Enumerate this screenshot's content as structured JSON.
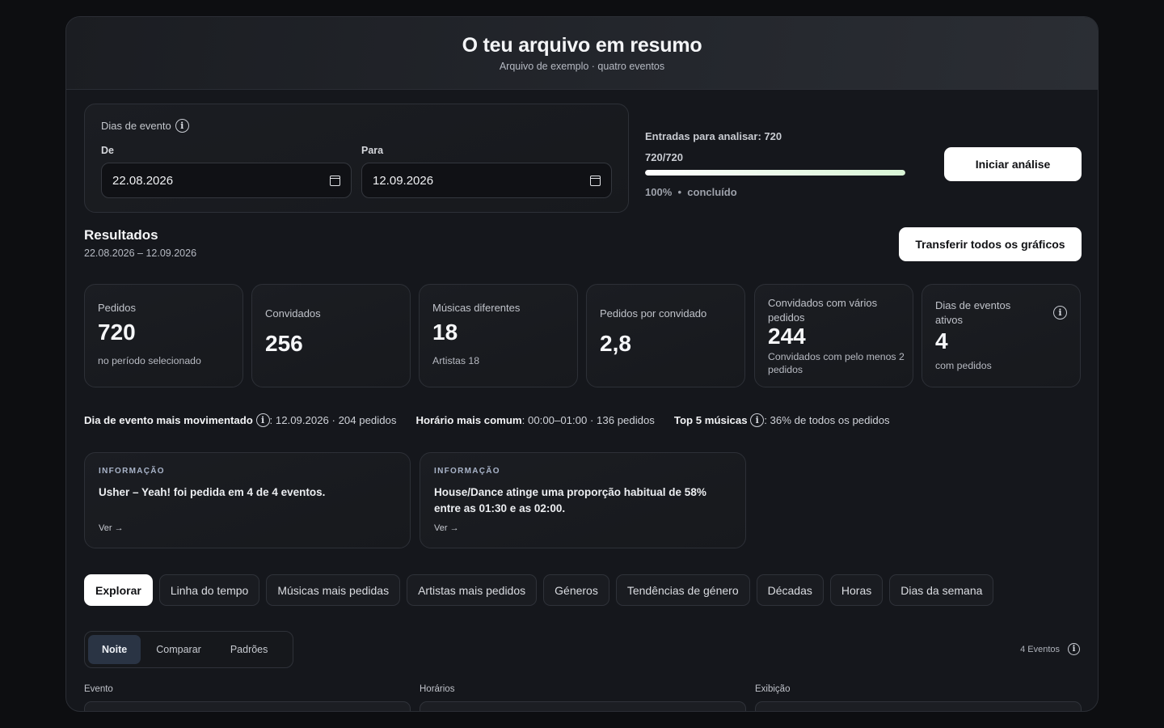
{
  "header": {
    "title": "O teu arquivo em resumo",
    "subtitle": "Arquivo de exemplo · quatro eventos"
  },
  "date_filter": {
    "label": "Dias de evento",
    "from_label": "De",
    "from_value": "22.08.2026",
    "to_label": "Para",
    "to_value": "12.09.2026"
  },
  "progress": {
    "entries_label": "Entradas para analisar: 720",
    "count": "720/720",
    "fraction": 1.0,
    "percent": "100%",
    "dot": "•",
    "status": "concluído"
  },
  "buttons": {
    "start": "Iniciar análise",
    "download_all": "Transferir todos os gráficos"
  },
  "results": {
    "title": "Resultados",
    "range": "22.08.2026 – 12.09.2026"
  },
  "stats": [
    {
      "label": "Pedidos",
      "value": "720",
      "desc": "no período selecionado"
    },
    {
      "label": "Convidados",
      "value": "256",
      "desc": ""
    },
    {
      "label": "Músicas diferentes",
      "value": "18",
      "desc": "Artistas 18"
    },
    {
      "label": "Pedidos por convidado",
      "value": "2,8",
      "desc": ""
    },
    {
      "label": "Convidados com vários pedidos",
      "value": "244",
      "desc": "Convidados com pelo menos 2 pedidos"
    },
    {
      "label": "Dias de eventos ativos",
      "value": "4",
      "desc": "com pedidos"
    }
  ],
  "facts": {
    "busiest_label": "Dia de evento mais movimentado",
    "busiest_value": ": 12.09.2026 · 204 pedidos",
    "common_hour_label": "Horário mais comum",
    "common_hour_value": ": 00:00–01:00 · 136 pedidos",
    "top5_label": "Top 5 músicas",
    "top5_value": ": 36% de todos os pedidos"
  },
  "insights": [
    {
      "tag": "INFORMAÇÃO",
      "text": "Usher – Yeah! foi pedida em 4 de 4 eventos.",
      "link": "Ver →"
    },
    {
      "tag": "INFORMAÇÃO",
      "text": "House/Dance atinge uma proporção habitual de 58% entre as 01:30 e as 02:00.",
      "link": "Ver →"
    }
  ],
  "tabs": [
    "Explorar",
    "Linha do tempo",
    "Músicas mais pedidas",
    "Artistas mais pedidos",
    "Géneros",
    "Tendências de género",
    "Décadas",
    "Horas",
    "Dias da semana"
  ],
  "segments": [
    "Noite",
    "Comparar",
    "Padrões"
  ],
  "events_count": "4 Eventos",
  "columns": [
    "Evento",
    "Horários",
    "Exibição"
  ],
  "info_glyph": "i"
}
